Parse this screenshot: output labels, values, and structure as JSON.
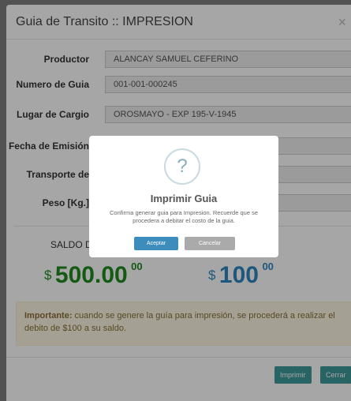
{
  "modal": {
    "title": "Guia de Transito :: IMPRESION",
    "close_glyph": "×"
  },
  "form": {
    "productor_label": "Productor",
    "productor_value": "ALANCAY SAMUEL CEFERINO",
    "numero_label": "Numero de Guia",
    "numero_value": "001-001-000245",
    "lugar_label": "Lugar de Cargio",
    "lugar_value": "OROSMAYO - EXP 195-V-1945",
    "fecha_label": "Fecha de Emisión",
    "fecha_value": "",
    "transporte_label": "Transporte de",
    "transporte_value": "",
    "peso_label": "Peso [Kg.]",
    "peso_value": ""
  },
  "saldo": {
    "label": "SALDO DI",
    "currency": "$",
    "saldo_whole": "500.",
    "saldo_cents_visible": "00",
    "saldo_sup": "00",
    "cost_whole": "100",
    "cost_sup": "00"
  },
  "alert": {
    "strong": "Importante:",
    "text": " cuando se genere la guía para impresión, se procederá a realizar el debito de $100 a su saldo."
  },
  "footer": {
    "print_label": "Imprimir",
    "close_label": "Cerrar"
  },
  "dialog": {
    "icon_glyph": "?",
    "title": "Imprimir Guia",
    "text": "Confirma generar guia para Impresion. Recuerde que se procedera a debitar el costo de la guia.",
    "ok_label": "Aceptar",
    "cancel_label": "Cancelar"
  },
  "colors": {
    "green_amount": "#1f8a1f",
    "blue_amount": "#2e86c1",
    "teal_button": "#3e9a9a",
    "ok_button": "#3c8dbc",
    "cancel_button": "#aaaaaa"
  }
}
